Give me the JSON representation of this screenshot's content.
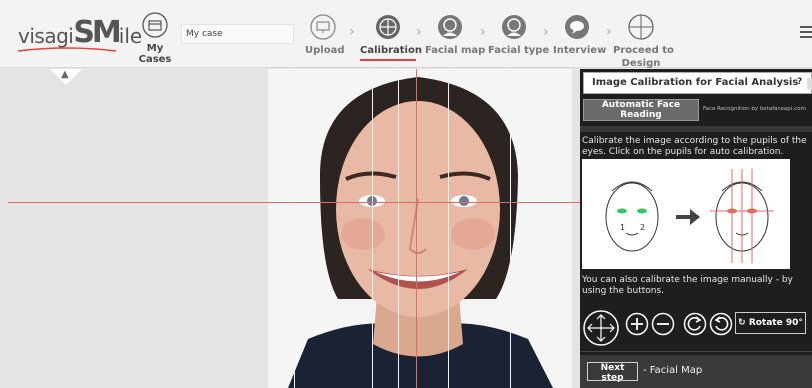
{
  "header": {
    "logo": {
      "part1": "visagi",
      "part2": "SM",
      "part3": "ile"
    },
    "my_cases": {
      "label": "My Cases",
      "icon": "folder-icon"
    },
    "case_name": "My case",
    "steps": [
      {
        "label": "Upload",
        "icon": "monitor-icon"
      },
      {
        "label": "Calibration",
        "icon": "globe-icon",
        "active": true
      },
      {
        "label": "Facial map",
        "icon": "face-icon"
      },
      {
        "label": "Facial type",
        "icon": "face-icon"
      },
      {
        "label": "Interview",
        "icon": "chat-icon"
      },
      {
        "label": "Proceed to",
        "label2": "Design",
        "icon": "crosshair-icon"
      }
    ],
    "menu_icon": "hamburger-icon",
    "accent_color": "#e0413a"
  },
  "canvas": {
    "collapse_icon": "chevron-up-icon",
    "guide_color": "#e36a65"
  },
  "panel": {
    "title": "Image Calibration for Facial Analysis",
    "help": "?",
    "auto_button": "Automatic Face Reading",
    "recognition_note": "Face Recognition by betafaceapi.com",
    "instruction": "Calibrate the image according to the pupils of the eyes. Click on the pupils for auto calibration.",
    "diagram_labels": [
      "1",
      "2"
    ],
    "manual_text": "You can also calibrate the image manually - by using the buttons.",
    "controls": [
      {
        "name": "move-icon"
      },
      {
        "name": "zoom-in-icon"
      },
      {
        "name": "zoom-out-icon"
      },
      {
        "name": "rotate-left-icon"
      },
      {
        "name": "rotate-right-icon"
      }
    ],
    "rotate_button": "Rotate 90°",
    "next_button": "Next step",
    "next_text": "- Facial Map"
  }
}
